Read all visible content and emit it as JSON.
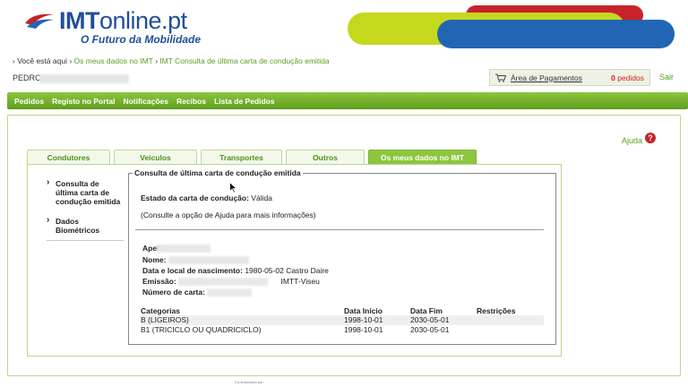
{
  "header": {
    "logo_bold": "IMT",
    "logo_light": "online.pt",
    "logo_sub": "O Futuro da Mobilidade"
  },
  "breadcrumb": {
    "prefix": "› Você está aqui ›",
    "link": "Os meus dados no IMT",
    "sep": "›",
    "current": "IMT Consulta de última carta de condução emitida"
  },
  "user": {
    "name": "PEDRC"
  },
  "payments": {
    "label": "Área de Pagamentos",
    "count": "0",
    "count_label": "pedidos",
    "logout": "Sair"
  },
  "menu": [
    "Pedidos",
    "Registo no Portal",
    "Notificações",
    "Recibos",
    "Lista de Pedidos"
  ],
  "help": {
    "label": "Ajuda",
    "icon": "?"
  },
  "tabs": [
    {
      "label": "Condutores",
      "active": false
    },
    {
      "label": "Veículos",
      "active": false
    },
    {
      "label": "Transportes",
      "active": false
    },
    {
      "label": "Outros",
      "active": false
    },
    {
      "label": "Os meus dados no IMT",
      "active": true
    }
  ],
  "side": {
    "item1": "Consulta de última carta de condução emitida",
    "item2": "Dados Biométricos"
  },
  "panel": {
    "legend": "Consulta de última carta de condução emitida",
    "estado_label": "Estado da carta de condução:",
    "estado_value": "Válida",
    "consulte": "(Consulte a opção de Ajuda para mais informações)",
    "apelido_label": "Apelido:",
    "nome_label": "Nome:",
    "nascimento_label": "Data e local de nascimento:",
    "nascimento_value": "1980-05-02",
    "nascimento_local": "Castro Daire",
    "emissao_label": "Emissão:",
    "emissao_value": "IMTT-Viseu",
    "numero_label": "Número de carta:"
  },
  "categories": {
    "headers": [
      "Categorias",
      "Data Início",
      "Data Fim",
      "Restrições"
    ],
    "rows": [
      [
        "B (LIGEIROS)",
        "1998-10-01",
        "2030-05-01",
        ""
      ],
      [
        "B1 (TRICICLO OU QUADRICICLO)",
        "1998-10-01",
        "2030-05-01",
        ""
      ]
    ]
  },
  "footer": {
    "note": "Co-financiado por:"
  },
  "colors": {
    "green": "#8cc63f",
    "link": "#5a9e1e",
    "blue": "#1f4e9c",
    "red": "#c8232c"
  }
}
